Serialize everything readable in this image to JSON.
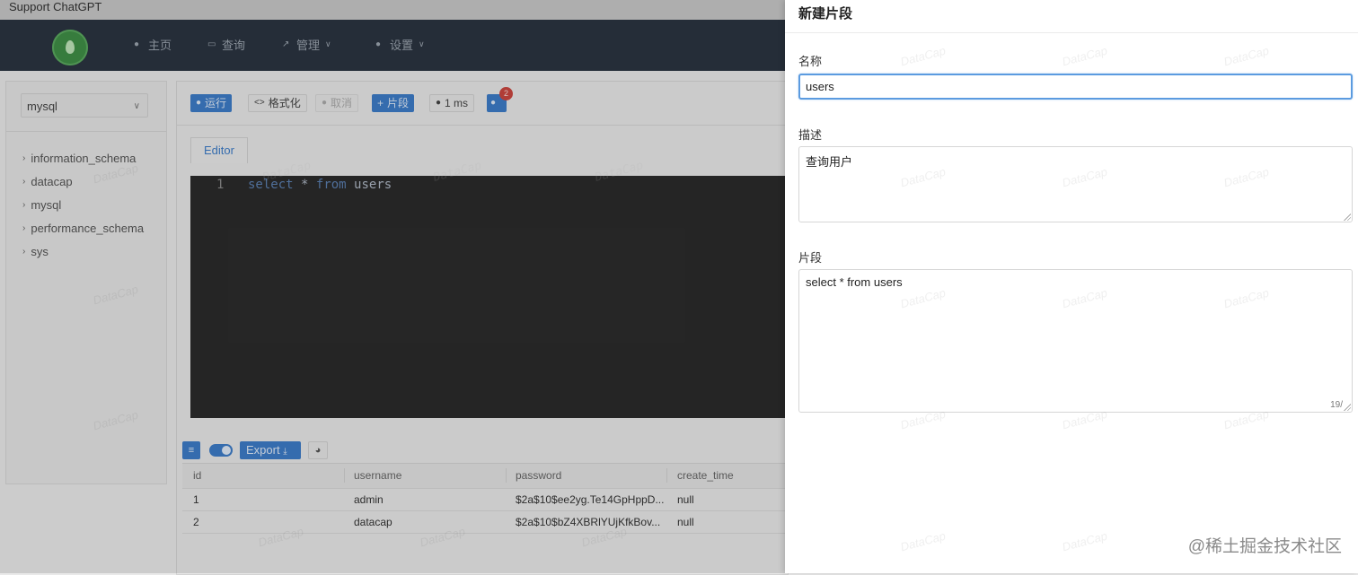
{
  "window": {
    "title": "Support ChatGPT"
  },
  "nav": {
    "items": [
      {
        "label": "主页",
        "icon": "home-icon"
      },
      {
        "label": "查询",
        "icon": "query-icon"
      },
      {
        "label": "管理",
        "icon": "manage-icon",
        "dropdown": true
      },
      {
        "label": "设置",
        "icon": "settings-icon",
        "dropdown": true
      }
    ]
  },
  "sidebar": {
    "datasource": "mysql",
    "databases": [
      "information_schema",
      "datacap",
      "mysql",
      "performance_schema",
      "sys"
    ]
  },
  "toolbar": {
    "run": "运行",
    "format": "格式化",
    "cancel": "取消",
    "snippet": "片段",
    "elapsed": "1 ms",
    "badge_count": "2"
  },
  "editor": {
    "tab": "Editor",
    "line_number": "1",
    "code_kw1": "select",
    "code_mid": "*",
    "code_kw2": "from",
    "code_rest": "users"
  },
  "results": {
    "export_label": "Export",
    "columns": [
      "id",
      "username",
      "password",
      "create_time"
    ],
    "rows": [
      [
        "1",
        "admin",
        "$2a$10$ee2yg.Te14GpHppD...",
        "null"
      ],
      [
        "2",
        "datacap",
        "$2a$10$bZ4XBRlYUjKfkBov...",
        "null"
      ]
    ]
  },
  "watermark": "DataCap",
  "drawer": {
    "title": "新建片段",
    "name_label": "名称",
    "name_value": "users",
    "desc_label": "描述",
    "desc_value": "查询用户",
    "snippet_label": "片段",
    "snippet_value": "select * from users",
    "snippet_count": "19/"
  },
  "footer_watermark": "@稀土掘金技术社区",
  "colors": {
    "primary": "#3d7cc6",
    "navbar": "#2b3440",
    "badge": "#c9463f",
    "focus": "#5b9be0"
  }
}
